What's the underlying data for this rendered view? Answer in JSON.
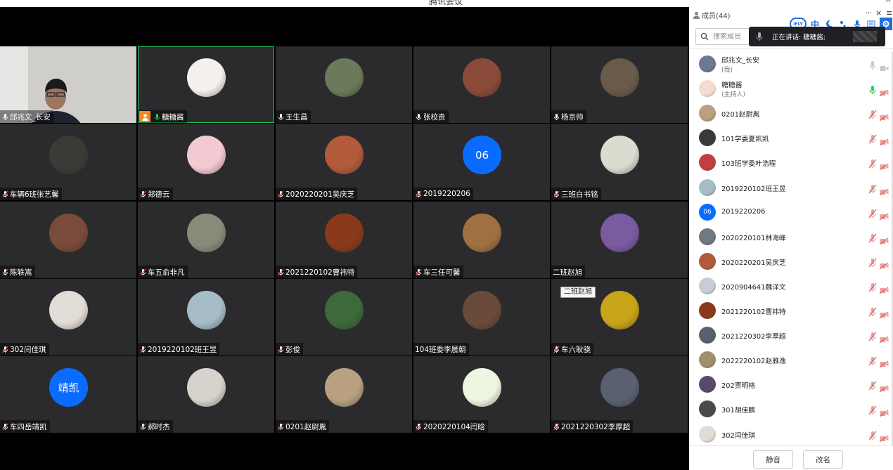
{
  "window": {
    "title": "腾讯会议",
    "minimize": "–",
    "close": "×"
  },
  "panel": {
    "members_title": "成员(44)",
    "more": "···",
    "close": "×",
    "menu": "≡",
    "search_placeholder": "搜索成员",
    "speaking_label": "正在讲话: 糖糖酱;",
    "toolbar": {
      "ifly": "iFLY",
      "zhong": "中"
    },
    "mute_all_label": "静音",
    "rename_label": "改名"
  },
  "tooltip": "二班赵旭",
  "grid_tiles": [
    {
      "name": "邱兆文_长安",
      "mic": "on",
      "camera": true
    },
    {
      "name": "糖糖酱",
      "mic": "active",
      "host": true,
      "speaking": true,
      "avatar_color": "#f4f1ec"
    },
    {
      "name": "王生昌",
      "mic": "on",
      "avatar_color": "#6b7a5a"
    },
    {
      "name": "张校贵",
      "mic": "on",
      "avatar_color": "#8a4a3a"
    },
    {
      "name": "杨京帅",
      "mic": "on",
      "avatar_color": "#6a5a4a"
    },
    {
      "name": "车辆6班张艺馨",
      "mic": "muted",
      "avatar_color": "#3a3a36"
    },
    {
      "name": "郑德云",
      "mic": "muted",
      "avatar_color": "#f3c9d2"
    },
    {
      "name": "2020220201吴庆芝",
      "mic": "muted",
      "avatar_color": "#b35a3a"
    },
    {
      "name": "2019220206",
      "mic": "muted",
      "avatar_text": "06",
      "avatar_color": "#0a6cff"
    },
    {
      "name": "三班白书铭",
      "mic": "muted",
      "avatar_color": "#d9dccf"
    },
    {
      "name": "陈轶嵩",
      "mic": "muted",
      "avatar_color": "#7a4a3a"
    },
    {
      "name": "车五俞非凡",
      "mic": "muted",
      "avatar_color": "#8a8a7a"
    },
    {
      "name": "2021220102曹祎特",
      "mic": "muted",
      "avatar_color": "#8a3a1a"
    },
    {
      "name": "车三任可馨",
      "mic": "muted",
      "avatar_color": "#a07040"
    },
    {
      "name": "二班赵旭",
      "mic": "none",
      "avatar_color": "#7a5aa0"
    },
    {
      "name": "302闫佳琪",
      "mic": "muted",
      "avatar_color": "#e2dcd6"
    },
    {
      "name": "2019220102班王昱",
      "mic": "muted",
      "avatar_color": "#a6bcc8"
    },
    {
      "name": "彭俊",
      "mic": "muted",
      "avatar_color": "#3c6a3a"
    },
    {
      "name": "104班委李晨朝",
      "mic": "none",
      "avatar_color": "#6a4a3a"
    },
    {
      "name": "车六耿骁",
      "mic": "muted",
      "avatar_color": "#c9a418"
    },
    {
      "name": "车四岳靖凯",
      "mic": "muted",
      "avatar_text": "靖凯",
      "avatar_color": "#0a6cff"
    },
    {
      "name": "郝时杰",
      "mic": "muted",
      "avatar_color": "#d8d2cc"
    },
    {
      "name": "0201赵尉胤",
      "mic": "muted",
      "avatar_color": "#b8a080"
    },
    {
      "name": "2020220104闫晗",
      "mic": "muted",
      "avatar_color": "#eef5e0"
    },
    {
      "name": "2021220302李厚超",
      "mic": "muted",
      "avatar_color": "#5a6070"
    }
  ],
  "members": [
    {
      "name": "邱兆文_长安",
      "role": "(我)",
      "mic": "off-gray",
      "cam": "gray",
      "avatar_color": "#6a7a90"
    },
    {
      "name": "糖糖酱",
      "role": "(主持人)",
      "mic": "active",
      "cam": "red",
      "avatar_color": "#f4ddd0"
    },
    {
      "name": "0201赵尉胤",
      "mic": "muted",
      "cam": "red",
      "avatar_color": "#b8a080"
    },
    {
      "name": "101学委夏凯凯",
      "mic": "muted",
      "cam": "red",
      "avatar_color": "#3a3a3a"
    },
    {
      "name": "103班学委叶浩程",
      "mic": "muted",
      "cam": "red",
      "avatar_color": "#c04040"
    },
    {
      "name": "2019220102班王昱",
      "mic": "muted",
      "cam": "red",
      "avatar_color": "#a6bcc8"
    },
    {
      "name": "2019220206",
      "mic": "muted",
      "cam": "red",
      "avatar_text": "06",
      "avatar_color": "#0a6cff"
    },
    {
      "name": "2020220101林海峰",
      "mic": "muted",
      "cam": "red",
      "avatar_color": "#707880"
    },
    {
      "name": "2020220201吴庆芝",
      "mic": "muted",
      "cam": "red",
      "avatar_color": "#b35a3a"
    },
    {
      "name": "2020904641魏洋文",
      "mic": "muted",
      "cam": "red",
      "avatar_color": "#c8ccd8"
    },
    {
      "name": "2021220102曹祎特",
      "mic": "muted",
      "cam": "red",
      "avatar_color": "#8a3a1a"
    },
    {
      "name": "2021220302李厚超",
      "mic": "muted",
      "cam": "red",
      "avatar_color": "#5a6070"
    },
    {
      "name": "2022220102赵雅逸",
      "mic": "muted",
      "cam": "red",
      "avatar_color": "#a09070"
    },
    {
      "name": "202贾明格",
      "mic": "muted",
      "cam": "red",
      "avatar_color": "#5a4a6a"
    },
    {
      "name": "301胡佳鹏",
      "mic": "muted",
      "cam": "red",
      "avatar_color": "#4a4a4a"
    },
    {
      "name": "302闫佳琪",
      "mic": "muted",
      "cam": "red",
      "avatar_color": "#e2dcd6"
    }
  ]
}
